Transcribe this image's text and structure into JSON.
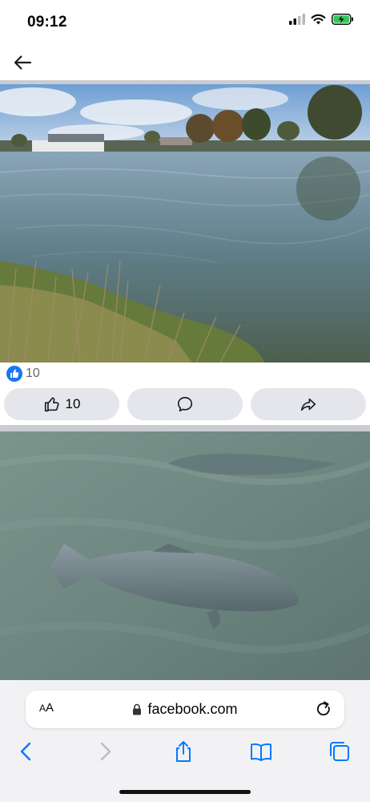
{
  "status_bar": {
    "time": "09:12",
    "signal_icon": "cellular-signal-icon",
    "wifi_icon": "wifi-icon",
    "battery_icon": "battery-charging-icon",
    "battery_color": "#34c759"
  },
  "nav": {
    "back_icon": "arrow-left-icon"
  },
  "post": {
    "reaction_icon": "like-reaction-icon",
    "reaction_count": "10",
    "like_count": "10",
    "like_icon": "thumbs-up-icon",
    "comment_icon": "comment-bubble-icon",
    "share_icon": "share-arrow-icon",
    "accent_color": "#1877f2"
  },
  "browser": {
    "aa_label_small": "A",
    "aa_label_large": "A",
    "url": "facebook.com",
    "lock_icon": "lock-icon",
    "reload_icon": "reload-icon",
    "back_icon": "chevron-left-icon",
    "forward_icon": "chevron-right-icon",
    "share_icon": "share-icon",
    "bookmarks_icon": "book-icon",
    "tabs_icon": "tabs-icon",
    "accent_color": "#007aff"
  }
}
